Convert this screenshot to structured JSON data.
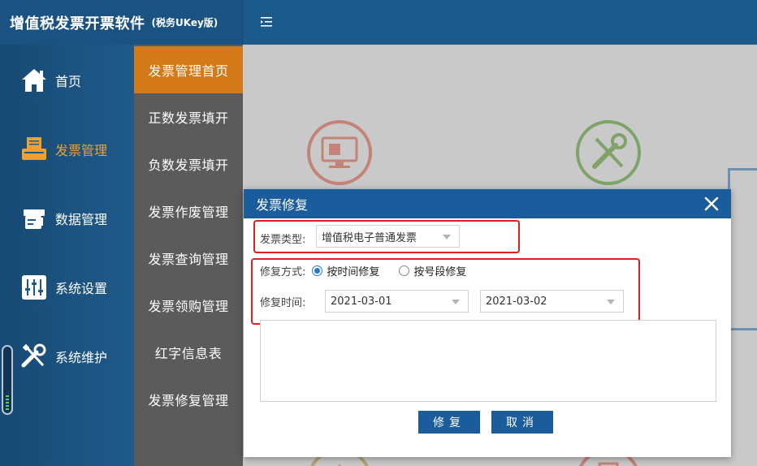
{
  "app": {
    "title": "增值税发票开票软件",
    "subtitle": "(税务UKey版)"
  },
  "leftnav": {
    "items": [
      {
        "label": "首页",
        "icon": "home-icon"
      },
      {
        "label": "发票管理",
        "icon": "invoice-printer-icon",
        "active": true
      },
      {
        "label": "数据管理",
        "icon": "data-manage-icon"
      },
      {
        "label": "系统设置",
        "icon": "settings-sliders-icon"
      },
      {
        "label": "系统维护",
        "icon": "tools-icon"
      }
    ],
    "volume_level": 0.25
  },
  "subnav": {
    "items": [
      {
        "label": "发票管理首页",
        "active": true
      },
      {
        "label": "正数发票填开"
      },
      {
        "label": "负数发票填开"
      },
      {
        "label": "发票作废管理"
      },
      {
        "label": "发票查询管理"
      },
      {
        "label": "发票领购管理"
      },
      {
        "label": "红字信息表"
      },
      {
        "label": "发票修复管理"
      }
    ]
  },
  "dialog": {
    "title": "发票修复",
    "invoice_type_label": "发票类型:",
    "invoice_type_value": "增值税电子普通发票",
    "repair_mode_label": "修复方式:",
    "mode_time": "按时间修复",
    "mode_number": "按号段修复",
    "selected_mode": "time",
    "repair_time_label": "修复时间:",
    "date_from": "2021-03-01",
    "date_to": "2021-03-02",
    "repair_button": "修复",
    "cancel_button": "取消"
  },
  "colors": {
    "topbar": "#1d5a8c",
    "active_sub": "#d57a18",
    "dialog_header": "#1b5c9c",
    "highlight_box": "#e02020"
  }
}
